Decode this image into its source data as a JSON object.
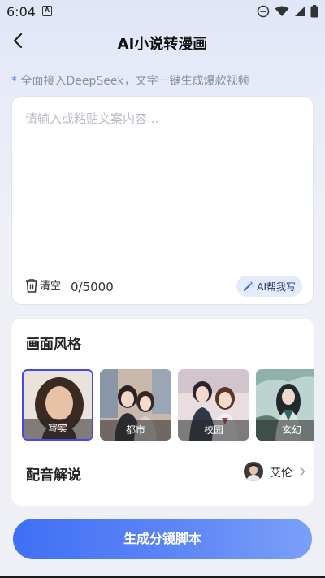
{
  "status_bar": {
    "time": "6:04",
    "notif_letter": "A"
  },
  "header": {
    "title": "AI小说转漫画"
  },
  "tip": {
    "star": "*",
    "text": " 全面接入DeepSeek，文字一键生成爆款视频"
  },
  "input": {
    "placeholder": "请输入或粘贴文案内容...",
    "clear_label": "清空",
    "char_count": "0/5000",
    "ai_write_label": "AI帮我写"
  },
  "style_section": {
    "title": "画面风格",
    "styles": [
      {
        "label": "写实",
        "selected": true
      },
      {
        "label": "都市",
        "selected": false
      },
      {
        "label": "校园",
        "selected": false
      },
      {
        "label": "玄幻",
        "selected": false
      }
    ]
  },
  "voice": {
    "title": "配音解说",
    "name": "艾伦"
  },
  "generate_button": {
    "label": "生成分镜脚本"
  },
  "colors": {
    "accent": "#4a6ff5",
    "selected_border": "#4a46e8"
  }
}
